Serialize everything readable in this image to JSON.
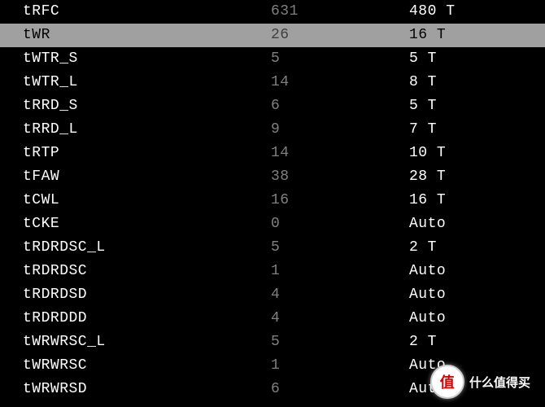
{
  "rows": [
    {
      "name": "tRFC",
      "val1": "631",
      "val2": "480 T",
      "highlight": false
    },
    {
      "name": "tWR",
      "val1": "26",
      "val2": "16 T",
      "highlight": true
    },
    {
      "name": "tWTR_S",
      "val1": "5",
      "val2": "5 T",
      "highlight": false
    },
    {
      "name": "tWTR_L",
      "val1": "14",
      "val2": "8 T",
      "highlight": false
    },
    {
      "name": "tRRD_S",
      "val1": "6",
      "val2": "5 T",
      "highlight": false
    },
    {
      "name": "tRRD_L",
      "val1": "9",
      "val2": "7 T",
      "highlight": false
    },
    {
      "name": "tRTP",
      "val1": "14",
      "val2": "10 T",
      "highlight": false
    },
    {
      "name": "tFAW",
      "val1": "38",
      "val2": "28 T",
      "highlight": false
    },
    {
      "name": "tCWL",
      "val1": "16",
      "val2": "16 T",
      "highlight": false
    },
    {
      "name": "tCKE",
      "val1": "0",
      "val2": "Auto",
      "highlight": false
    },
    {
      "name": "tRDRDSC_L",
      "val1": "5",
      "val2": "2 T",
      "highlight": false
    },
    {
      "name": "tRDRDSC",
      "val1": "1",
      "val2": "Auto",
      "highlight": false
    },
    {
      "name": "tRDRDSD",
      "val1": "4",
      "val2": "Auto",
      "highlight": false
    },
    {
      "name": "tRDRDDD",
      "val1": "4",
      "val2": "Auto",
      "highlight": false
    },
    {
      "name": "tWRWRSC_L",
      "val1": "5",
      "val2": "2 T",
      "highlight": false
    },
    {
      "name": "tWRWRSC",
      "val1": "1",
      "val2": "Auto",
      "highlight": false
    },
    {
      "name": "tWRWRSD",
      "val1": "6",
      "val2": "Auto",
      "highlight": false
    }
  ],
  "watermark": {
    "icon": "值",
    "text": "什么值得买"
  }
}
